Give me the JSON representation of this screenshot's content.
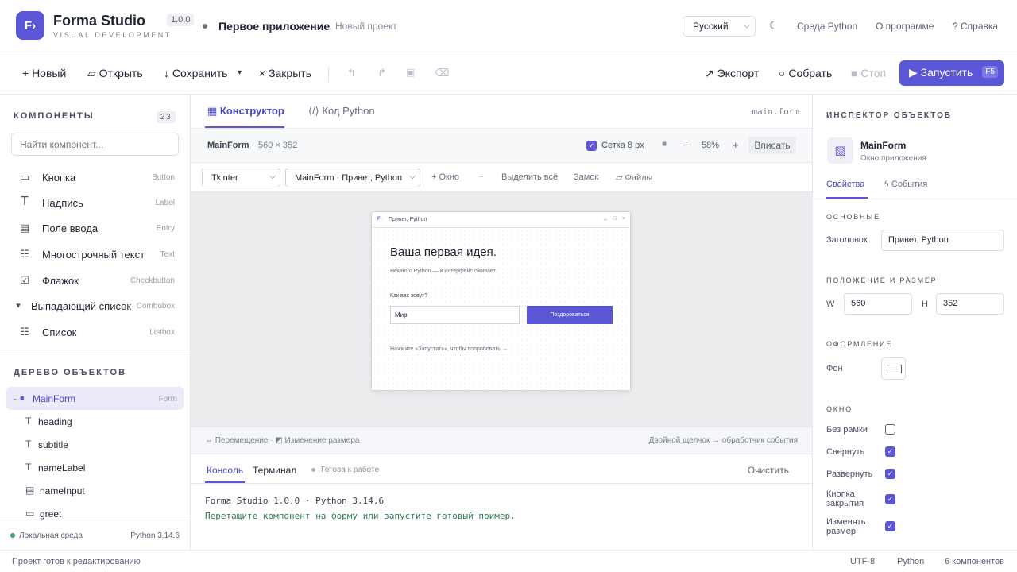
{
  "header": {
    "logo_glyph": "F›",
    "brand": "Forma Studio",
    "brand_sub": "VISUAL DEVELOPMENT",
    "version": "1.0.0",
    "project_title": "Первое приложение",
    "project_sub": "Новый проект",
    "language": "Русский",
    "links": [
      "Среда Python",
      "О программе",
      "? Справка"
    ]
  },
  "toolbar": {
    "new": "+ Новый",
    "open": "▱ Открыть",
    "save": "↓ Сохранить",
    "save_more": "▾",
    "close": "× Закрыть",
    "export": "↗ Экспорт",
    "build": "○ Собрать",
    "stop": "■ Стоп",
    "run": "▶ Запустить",
    "run_key": "F5"
  },
  "components": {
    "title": "КОМПОНЕНТЫ",
    "count": "23",
    "search_placeholder": "Найти компонент...",
    "items": [
      {
        "icon": "▭",
        "name": "Кнопка",
        "type": "Button"
      },
      {
        "icon": "T",
        "name": "Надпись",
        "type": "Label"
      },
      {
        "icon": "▤",
        "name": "Поле ввода",
        "type": "Entry"
      },
      {
        "icon": "☷",
        "name": "Многострочный текст",
        "type": "Text"
      },
      {
        "icon": "☑",
        "name": "Флажок",
        "type": "Checkbutton"
      },
      {
        "icon": "▾",
        "name": "Выпадающий список",
        "type": "Combobox"
      },
      {
        "icon": "☷",
        "name": "Список",
        "type": "Listbox"
      }
    ]
  },
  "tree": {
    "title": "ДЕРЕВО ОБЪЕКТОВ",
    "root": {
      "name": "MainForm",
      "type": "Form"
    },
    "children": [
      {
        "icon": "T",
        "name": "heading"
      },
      {
        "icon": "T",
        "name": "subtitle"
      },
      {
        "icon": "T",
        "name": "nameLabel"
      },
      {
        "icon": "▤",
        "name": "nameInput"
      },
      {
        "icon": "▭",
        "name": "greet"
      }
    ]
  },
  "left_footer": {
    "env": "Локальная среда",
    "python": "Python 3.14.6"
  },
  "center": {
    "tab_designer": "▦ Конструктор",
    "tab_code": "⟨/⟩ Код Python",
    "file": "main.form",
    "form_name": "MainForm",
    "form_size": "560 × 352",
    "grid_label": "Сетка 8 px",
    "zoom": "58%",
    "fit": "Вписать",
    "framework": "Tkinter",
    "form_select": "MainForm · Привет, Python",
    "add_window": "+ Окно",
    "remove": "−",
    "select_all": "Выделить всё",
    "lock": "Замок",
    "files": "▱ Файлы",
    "hint_left": "⇔ Перемещение · ◩ Изменение размера",
    "hint_right": "Двойной щелчок → обработчик события"
  },
  "form_window": {
    "icon": "F›",
    "title": "Привет, Python",
    "heading": "Ваша первая идея.",
    "subtitle": "Немного Python — и интерфейс оживает.",
    "name_label": "Как вас зовут?",
    "name_value": "Мир",
    "button": "Поздороваться",
    "hint": "Нажмите «Запустить», чтобы попробовать →"
  },
  "console": {
    "tab_console": "Консоль",
    "tab_terminal": "Терминал",
    "status": "Готова к работе",
    "clear": "Очистить",
    "line1": "Forma Studio 1.0.0 · Python 3.14.6",
    "line2": "Перетащите компонент на форму или запустите готовый пример."
  },
  "inspector": {
    "title": "ИНСПЕКТОР ОБЪЕКТОВ",
    "object_name": "MainForm",
    "object_type": "Окно приложения",
    "tab_props": "Свойства",
    "tab_events": "ϟ События",
    "sec_basic": "ОСНОВНЫЕ",
    "title_label": "Заголовок",
    "title_value": "Привет, Python",
    "sec_pos": "ПОЛОЖЕНИЕ И РАЗМЕР",
    "w_label": "W",
    "w_value": "560",
    "h_label": "H",
    "h_value": "352",
    "sec_style": "ОФОРМЛЕНИЕ",
    "bg_label": "Фон",
    "sec_window": "ОКНО",
    "flags": [
      {
        "label": "Без рамки",
        "checked": false
      },
      {
        "label": "Свернуть",
        "checked": true
      },
      {
        "label": "Развернуть",
        "checked": true
      },
      {
        "label": "Кнопка закрытия",
        "checked": true
      },
      {
        "label": "Изменять размер",
        "checked": true
      }
    ]
  },
  "status": {
    "left": "Проект готов к редактированию",
    "encoding": "UTF-8",
    "language": "Python",
    "components": "6 компонентов"
  },
  "colors": {
    "accent": "#5b56d6",
    "console_green": "#2e7d4f"
  }
}
